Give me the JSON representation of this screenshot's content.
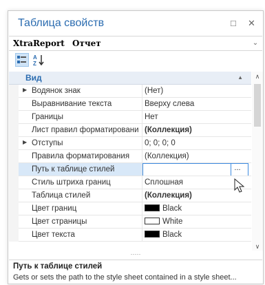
{
  "window": {
    "title": "Таблица свойств",
    "pin": "□",
    "close": "✕"
  },
  "object_selector": {
    "name": "XtraReport",
    "type": "Отчет",
    "dropdown": "⌄"
  },
  "toolbar": {
    "categorized_label": "Categorized",
    "alphabetical_label": "Alphabetical"
  },
  "category": {
    "label": "Вид",
    "arrow": "▲"
  },
  "rows": [
    {
      "name": "Водянок знак",
      "value": "(Нет)",
      "expandable": true
    },
    {
      "name": "Выравнивание текста",
      "value": "Вверху слева"
    },
    {
      "name": "Границы",
      "value": "Нет"
    },
    {
      "name": "Лист правил форматировани",
      "value": "(Коллекция)",
      "bold": true
    },
    {
      "name": "Отступы",
      "value": "0; 0; 0; 0",
      "expandable": true
    },
    {
      "name": "Правила форматирования",
      "value": "(Коллекция)"
    },
    {
      "name": "Путь к таблице стилей",
      "value": "",
      "selected": true,
      "ellipsis": "..."
    },
    {
      "name": "Стиль штриха границ",
      "value": "Сплошная"
    },
    {
      "name": "Таблица стилей",
      "value": "(Коллекция)",
      "bold": true
    },
    {
      "name": "Цвет границ",
      "value": "Black",
      "swatch": "#000000"
    },
    {
      "name": "Цвет страницы",
      "value": "White",
      "swatch": "#ffffff"
    },
    {
      "name": "Цвет текста",
      "value": "Black",
      "swatch": "#000000"
    }
  ],
  "splitter": "·····",
  "description": {
    "title": "Путь к таблице стилей",
    "text": "Gets or sets the path to the style sheet contained in a style sheet..."
  },
  "colors": {
    "accent": "#2b6cb0",
    "selection": "#d8e8f8",
    "focus_border": "#3c8ae0"
  }
}
